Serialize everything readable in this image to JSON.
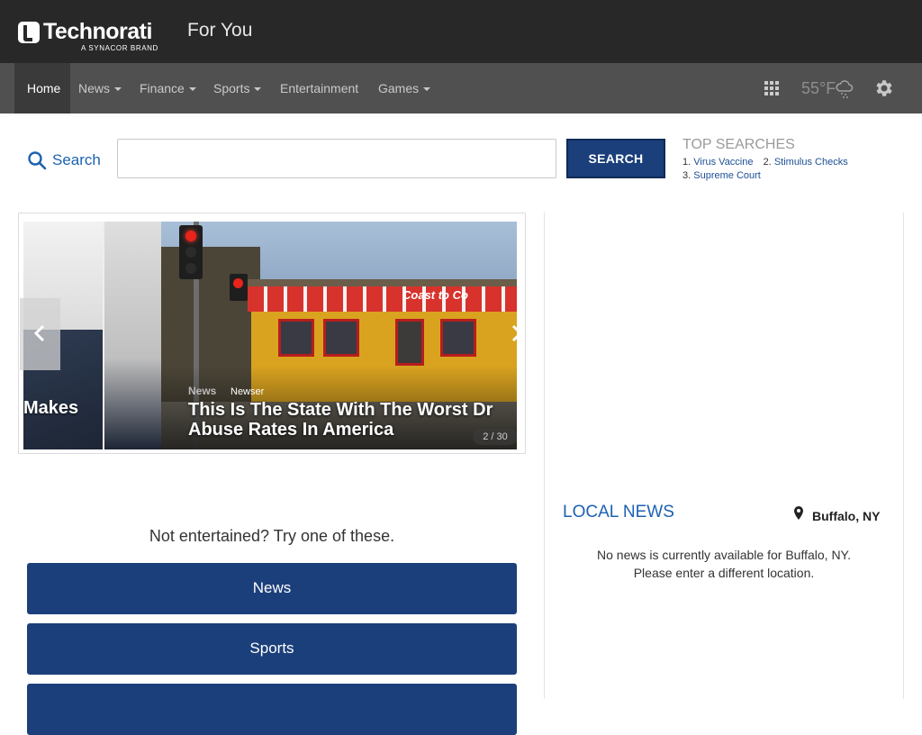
{
  "brand": {
    "name": "Technorati",
    "subtitle": "A SYNACOR BRAND"
  },
  "header": {
    "for_you": "For You"
  },
  "nav": {
    "items": [
      {
        "label": "Home"
      },
      {
        "label": "News"
      },
      {
        "label": "Finance"
      },
      {
        "label": "Sports"
      },
      {
        "label": "Entertainment"
      },
      {
        "label": "Games"
      }
    ],
    "temperature": "55°F",
    "icons": [
      "apps-grid-icon",
      "weather-rain-icon",
      "gear-icon"
    ]
  },
  "search": {
    "label": "Search",
    "input_value": "",
    "input_placeholder": "",
    "button_label": "SEARCH"
  },
  "top_searches": {
    "title": "TOP SEARCHES",
    "items": [
      {
        "rank": "1.",
        "label": "Virus Vaccine"
      },
      {
        "rank": "2.",
        "label": "Stimulus Checks"
      },
      {
        "rank": "3.",
        "label": "Supreme Court"
      }
    ]
  },
  "carousel": {
    "prev_title": "Makes",
    "category": "News",
    "source": "Newser",
    "title_line1": "This Is The State With The Worst Dr",
    "title_line2": "Abuse Rates In America",
    "counter": "2 / 30",
    "storefront_sign": "Coast to Co"
  },
  "try_these": {
    "heading": "Not entertained? Try one of these.",
    "buttons": [
      "News",
      "Sports",
      ""
    ]
  },
  "local_news": {
    "title": "LOCAL NEWS",
    "location": "Buffalo, NY",
    "message_line1": "No news is currently available for Buffalo, NY.",
    "message_line2": "Please enter a different location."
  },
  "colors": {
    "topbar": "#282828",
    "navbar": "#505050",
    "accent_blue": "#1c62b1",
    "button_blue": "#1b3f7a"
  }
}
